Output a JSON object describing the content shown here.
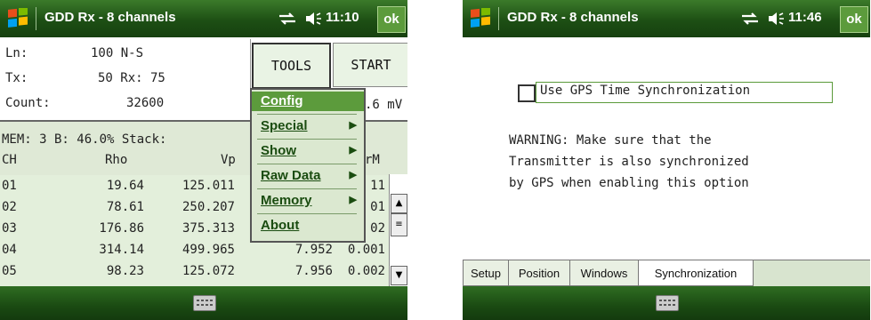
{
  "colors": {
    "title_bar": "#1d4f14",
    "menu_bg": "#dbe8d0",
    "table_bg": "#e3efdb",
    "accent": "#5c9b3c"
  },
  "left": {
    "title": "GDD Rx - 8 channels",
    "time": "11:10",
    "ok": "ok",
    "status_icons": [
      "connectivity-icon",
      "speaker-icon"
    ],
    "ln_label": "Ln:",
    "ln_value": "100 N-S",
    "tx_label": "Tx:",
    "tx_value": "50 Rx: 75",
    "count_label": "Count:",
    "count_value": "32600",
    "tools_button": "TOOLS",
    "start_button": "START",
    "partial_value": ".6  mV",
    "mem_line": "MEM: 3 B: 46.0% Stack:",
    "headers": {
      "ch": "CH",
      "rho": "Rho",
      "vp": "Vp",
      "right": "rM"
    },
    "rows": [
      {
        "ch": "01",
        "rho": "19.64",
        "vp": "125.011",
        "tail": "11"
      },
      {
        "ch": "02",
        "rho": "78.61",
        "vp": "250.207",
        "tail": "01"
      },
      {
        "ch": "03",
        "rho": "176.86",
        "vp": "375.313",
        "tail": "02"
      },
      {
        "ch": "04",
        "rho": "314.14",
        "vp": "499.965",
        "tail": "7.952  0.001"
      },
      {
        "ch": "05",
        "rho": "98.23",
        "vp": "125.072",
        "tail": "7.956  0.002"
      }
    ],
    "menu": [
      {
        "label": "Config",
        "submenu": false,
        "selected": true
      },
      {
        "label": "Special",
        "submenu": true
      },
      {
        "label": "Show",
        "submenu": true
      },
      {
        "label": "Raw Data",
        "submenu": true
      },
      {
        "label": "Memory",
        "submenu": true
      },
      {
        "label": "About",
        "submenu": false
      }
    ]
  },
  "right": {
    "title": "GDD Rx - 8 channels",
    "time": "11:46",
    "ok": "ok",
    "gps_checkbox_label": "Use GPS Time Synchronization",
    "gps_checked": false,
    "warning_lines": [
      "WARNING: Make sure that the",
      "Transmitter is also synchronized",
      "by GPS when enabling this option"
    ],
    "tabs": [
      "Setup",
      "Position",
      "Windows",
      "Synchronization"
    ],
    "active_tab": "Synchronization"
  }
}
